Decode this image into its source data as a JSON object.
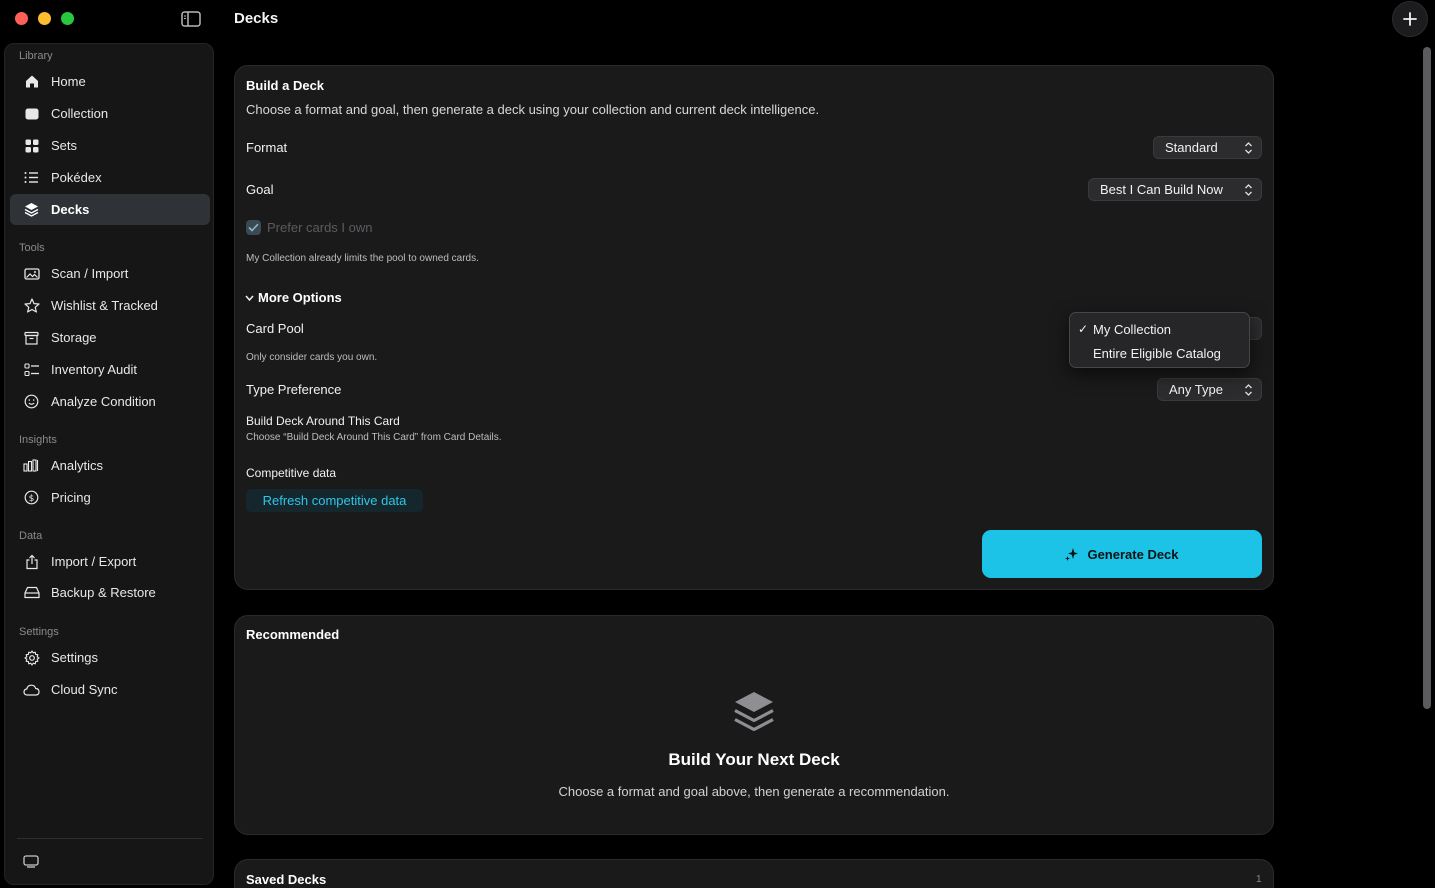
{
  "window": {
    "title": "Decks"
  },
  "sidebar": {
    "sections": [
      {
        "title": "Library",
        "items": [
          {
            "label": "Home",
            "icon": "house-icon"
          },
          {
            "label": "Collection",
            "icon": "tray-icon"
          },
          {
            "label": "Sets",
            "icon": "grid-icon"
          },
          {
            "label": "Pokédex",
            "icon": "list-icon"
          },
          {
            "label": "Decks",
            "icon": "stack-icon",
            "active": true
          }
        ]
      },
      {
        "title": "Tools",
        "items": [
          {
            "label": "Scan / Import",
            "icon": "photo-icon"
          },
          {
            "label": "Wishlist & Tracked",
            "icon": "star-icon"
          },
          {
            "label": "Storage",
            "icon": "archive-box-icon"
          },
          {
            "label": "Inventory Audit",
            "icon": "checklist-icon"
          },
          {
            "label": "Analyze Condition",
            "icon": "smiley-circle-icon"
          }
        ]
      },
      {
        "title": "Insights",
        "items": [
          {
            "label": "Analytics",
            "icon": "bar-chart-icon"
          },
          {
            "label": "Pricing",
            "icon": "dollar-circle-icon"
          }
        ]
      },
      {
        "title": "Data",
        "items": [
          {
            "label": "Import / Export",
            "icon": "share-icon"
          },
          {
            "label": "Backup & Restore",
            "icon": "drive-icon"
          }
        ]
      },
      {
        "title": "Settings",
        "items": [
          {
            "label": "Settings",
            "icon": "gear-icon"
          },
          {
            "label": "Cloud Sync",
            "icon": "cloud-icon"
          }
        ]
      }
    ]
  },
  "build": {
    "title": "Build a Deck",
    "description": "Choose a format and goal, then generate a deck using your collection and current deck intelligence.",
    "format_label": "Format",
    "format_value": "Standard",
    "goal_label": "Goal",
    "goal_value": "Best I Can Build Now",
    "prefer_owned_label": "Prefer cards I own",
    "prefer_owned_checked": true,
    "prefer_owned_note": "My Collection already limits the pool to owned cards.",
    "more_options_label": "More Options",
    "card_pool_label": "Card Pool",
    "card_pool_note": "Only consider cards you own.",
    "card_pool_options": [
      "My Collection",
      "Entire Eligible Catalog"
    ],
    "card_pool_selected": "My Collection",
    "type_pref_label": "Type Preference",
    "type_pref_value": "Any Type",
    "build_around_label": "Build Deck Around This Card",
    "build_around_note": "Choose “Build Deck Around This Card” from Card Details.",
    "competitive_label": "Competitive data",
    "refresh_label": "Refresh competitive data",
    "generate_label": "Generate Deck"
  },
  "recommended": {
    "title": "Recommended",
    "empty_title": "Build Your Next Deck",
    "empty_text": "Choose a format and goal above, then generate a recommendation."
  },
  "saved": {
    "title": "Saved Decks",
    "count": "1"
  },
  "colors": {
    "accent": "#1cc3e6",
    "background": "#000000",
    "card": "#1a1a1b",
    "sidebar_active": "#2f3236"
  }
}
